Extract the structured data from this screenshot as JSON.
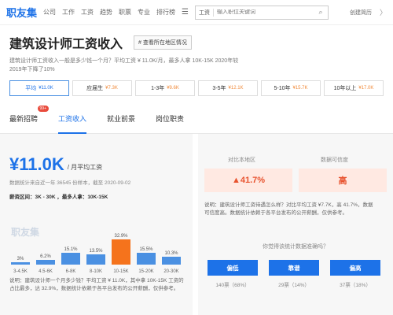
{
  "nav": {
    "logo": "职友集",
    "items": [
      "公司",
      "工作",
      "工资",
      "趋势",
      "职票",
      "专业",
      "排行榜"
    ],
    "search_scope": "工资",
    "search_placeholder": "输入职位关键词",
    "create_resume": "创建简历",
    "more": "〉"
  },
  "page": {
    "title": "建筑设计师工资收入",
    "region_button": "# 查看所在地区情况",
    "description": "建筑设计师工资收入一般是多少钱一个月？平均工资 ¥ 11.0K/月，最多人拿 10K-15K 2020年较2019年下降了10%"
  },
  "experience_chips": [
    {
      "label": "平均",
      "value": "¥11.0K",
      "active": true
    },
    {
      "label": "应届生",
      "value": "¥7.3K",
      "active": false
    },
    {
      "label": "1-3年",
      "value": "¥9.6K",
      "active": false
    },
    {
      "label": "3-5年",
      "value": "¥12.1K",
      "active": false
    },
    {
      "label": "5-10年",
      "value": "¥15.7K",
      "active": false
    },
    {
      "label": "10年以上",
      "value": "¥17.0K",
      "active": false
    }
  ],
  "tabs": [
    {
      "label": "最新招聘",
      "badge": "99+"
    },
    {
      "label": "工资收入",
      "active": true
    },
    {
      "label": "就业前景"
    },
    {
      "label": "岗位职责"
    }
  ],
  "left": {
    "salary": "¥11.0K",
    "unit": "/ 月平均工资",
    "stats": "数据统计来自近一年 36545 份样本，截至 2020-09-02",
    "range_info": "薪资区间：3K - 30K ，最多人拿：10K-15K",
    "watermark": "职友集",
    "note": "说明：建筑设计师一个月多少钱？平均工资 ¥ 11.0K，其中拿 10K-15K 工资的占比最多，达 32.9%，数据统计依赖于各平台发布的公开薪酬，仅供参考。"
  },
  "chart_data": {
    "type": "bar",
    "categories": [
      "3-4.5K",
      "4.5-6K",
      "6-8K",
      "8-10K",
      "10-15K",
      "15-20K",
      "20-30K"
    ],
    "values": [
      3,
      6.2,
      15.1,
      13.5,
      32.9,
      15.5,
      10.3
    ],
    "value_labels": [
      "3%",
      "6.2%",
      "15.1%",
      "13.5%",
      "32.9%",
      "15.5%",
      "10.3%"
    ],
    "highlight_index": 4,
    "colors": {
      "bar": "#4a90e2",
      "highlight": "#f5731c"
    }
  },
  "right": {
    "compare_header": "对比本地区",
    "credibility_header": "数据可信度",
    "compare_value": "▲41.7%",
    "credibility_value": "高",
    "note": "说明：建筑设计师工资待遇怎么样？对比平均工资 ¥7.7K，高 41.7%，数据可信度高。数据统计依赖于各平台发布的公开薪酬，仅供参考。",
    "question": "你觉得该统计数据准确吗？",
    "vote_buttons": [
      "偏低",
      "靠谱",
      "偏高"
    ],
    "vote_counts": [
      "140票（68%）",
      "29票（14%）",
      "37票（18%）"
    ]
  }
}
